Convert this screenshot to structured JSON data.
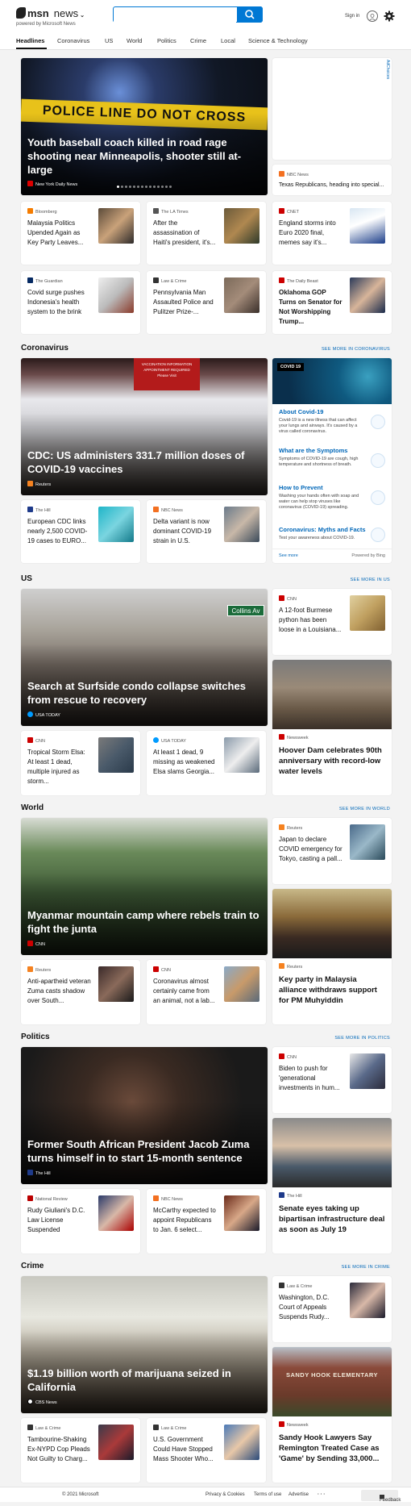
{
  "header": {
    "brand": "msn",
    "section": "news",
    "tagline": "powered by Microsoft News",
    "search_placeholder": "",
    "signin": "Sign in"
  },
  "nav": [
    "Headlines",
    "Coronavirus",
    "US",
    "World",
    "Politics",
    "Crime",
    "Local",
    "Science & Technology"
  ],
  "top": {
    "hero": {
      "title": "Youth baseball coach killed in road rage shooting near Minneapolis, shooter still at-large",
      "source": "New York Daily News",
      "banner_text": "POLICE LINE DO NOT CROSS"
    },
    "ad_label": "AdChoices",
    "side": {
      "source": "NBC News",
      "headline": "Texas Republicans, heading into special..."
    },
    "cards": [
      {
        "source": "Bloomberg",
        "headline": "Malaysia Politics Upended Again as Key Party Leaves..."
      },
      {
        "source": "The LA Times",
        "headline": "After the assassination of Haiti's president, it's..."
      },
      {
        "source": "CNET",
        "headline": "England storms into Euro 2020 final, memes say it's..."
      },
      {
        "source": "The Guardian",
        "headline": "Covid surge pushes Indonesia's health system to the brink"
      },
      {
        "source": "Law & Crime",
        "headline": "Pennsylvania Man Assaulted Police and Pulitzer Prize-..."
      },
      {
        "source": "The Daily Beast",
        "headline": "Oklahoma GOP Turns on Senator for Not Worshipping Trump..."
      }
    ]
  },
  "coronavirus": {
    "title": "Coronavirus",
    "more": "SEE MORE IN CORONAVIRUS",
    "hero": {
      "title": "CDC: US administers 331.7 million doses of COVID-19 vaccines",
      "source": "Reuters",
      "sign_lines": [
        "VACCINATION INFORMATION",
        "APPOINTMENT REQUIRED",
        "Please Visit"
      ]
    },
    "cards": [
      {
        "source": "The Hill",
        "headline": "European CDC links nearly 2,500 COVID-19 cases to EURO..."
      },
      {
        "source": "NBC News",
        "headline": "Delta variant is now dominant COVID-19 strain in U.S."
      }
    ],
    "info": {
      "badge": "COVID 19",
      "items": [
        {
          "title": "About Covid-19",
          "text": "Covid-19 is a new illness that can affect your lungs and airways. It's caused by a virus called coronavirus."
        },
        {
          "title": "What are the Symptoms",
          "text": "Symptoms of COVID-19 are cough, high temperature and shortness of breath."
        },
        {
          "title": "How to Prevent",
          "text": "Washing your hands often with soap and water can help stop viruses like coronavirus (COVID-19) spreading."
        },
        {
          "title": "Coronavirus: Myths and Facts",
          "text": "Test your awareness about COVID-19."
        }
      ],
      "see_more": "See more",
      "powered": "Powered by Bing"
    }
  },
  "us": {
    "title": "US",
    "more": "SEE MORE IN US",
    "hero": {
      "title": "Search at Surfside condo collapse switches from rescue to recovery",
      "source": "USA TODAY",
      "street_sign": "Collins Av"
    },
    "side": {
      "source": "CNN",
      "headline": "A 12-foot Burmese python has been loose in a Louisiana..."
    },
    "big": {
      "source": "Newsweek",
      "headline": "Hoover Dam celebrates 90th anniversary with record-low water levels"
    },
    "cards": [
      {
        "source": "CNN",
        "headline": "Tropical Storm Elsa: At least 1 dead, multiple injured as storm..."
      },
      {
        "source": "USA TODAY",
        "headline": "At least 1 dead, 9 missing as weakened Elsa slams Georgia..."
      }
    ]
  },
  "world": {
    "title": "World",
    "more": "SEE MORE IN WORLD",
    "hero": {
      "title": "Myanmar mountain camp where rebels train to fight the junta",
      "source": "CNN"
    },
    "side": {
      "source": "Reuters",
      "headline": "Japan to declare COVID emergency for Tokyo, casting a pall..."
    },
    "big": {
      "source": "Reuters",
      "headline": "Key party in Malaysia alliance withdraws support for PM Muhyiddin"
    },
    "cards": [
      {
        "source": "Reuters",
        "headline": "Anti-apartheid veteran Zuma casts shadow over South..."
      },
      {
        "source": "CNN",
        "headline": "Coronavirus almost certainly came from an animal, not a lab..."
      }
    ]
  },
  "politics": {
    "title": "Politics",
    "more": "SEE MORE IN POLITICS",
    "hero": {
      "title": "Former South African President Jacob Zuma turns himself in to start 15-month sentence",
      "source": "The Hill"
    },
    "side": {
      "source": "CNN",
      "headline": "Biden to push for 'generational investments in hum..."
    },
    "big": {
      "source": "The Hill",
      "headline": "Senate eyes taking up bipartisan infrastructure deal as soon as July 19"
    },
    "cards": [
      {
        "source": "National Review",
        "headline": "Rudy Giuliani's D.C. Law License Suspended"
      },
      {
        "source": "NBC News",
        "headline": "McCarthy expected to appoint Republicans to Jan. 6 select..."
      }
    ]
  },
  "crime": {
    "title": "Crime",
    "more": "SEE MORE IN CRIME",
    "hero": {
      "title": "$1.19 billion worth of marijuana seized in California",
      "source": "CBS News"
    },
    "side": {
      "source": "Law & Crime",
      "headline": "Washington, D.C. Court of Appeals Suspends Rudy..."
    },
    "big": {
      "source": "Newsweek",
      "headline": "Sandy Hook Lawyers Say Remington Treated Case as 'Game' by Sending 33,000...",
      "sign": "SANDY HOOK ELEMENTARY"
    },
    "cards": [
      {
        "source": "Law & Crime",
        "headline": "Tambourine-Shaking Ex-NYPD Cop Pleads Not Guilty to Charg..."
      },
      {
        "source": "Law & Crime",
        "headline": "U.S. Government Could Have Stopped Mass Shooter Who..."
      }
    ]
  },
  "footer": {
    "copyright": "© 2021 Microsoft",
    "privacy": "Privacy & Cookies",
    "terms": "Terms of use",
    "advertise": "Advertise",
    "more": "· · ·",
    "feedback": "Feedback"
  }
}
